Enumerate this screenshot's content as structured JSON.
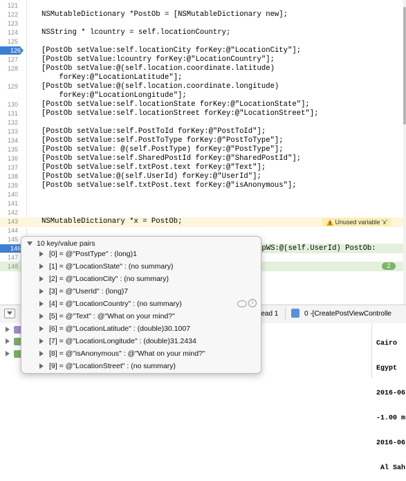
{
  "code_lines": [
    {
      "n": "121",
      "text": ""
    },
    {
      "n": "122",
      "text": "NSMutableDictionary *PostOb = [NSMutableDictionary new];"
    },
    {
      "n": "123",
      "text": ""
    },
    {
      "n": "124",
      "text": "NSString * lcountry = self.locationCountry;"
    },
    {
      "n": "125",
      "text": ""
    },
    {
      "n": "126",
      "text": "[PostOb setValue:self.locationCity forKey:@\"LocationCity\"];"
    },
    {
      "n": "127",
      "text": "[PostOb setValue:lcountry forKey:@\"LocationCountry\"];"
    },
    {
      "n": "128",
      "text": "[PostOb setValue:@(self.location.coordinate.latitude)"
    },
    {
      "n": "",
      "text": "    forKey:@\"LocationLatitude\"];"
    },
    {
      "n": "129",
      "text": "[PostOb setValue:@(self.location.coordinate.longitude)"
    },
    {
      "n": "",
      "text": "    forKey:@\"LocationLongitude\"];"
    },
    {
      "n": "130",
      "text": "[PostOb setValue:self.locationState forKey:@\"LocationState\"];"
    },
    {
      "n": "131",
      "text": "[PostOb setValue:self.locationStreet forKey:@\"LocationStreet\"];"
    },
    {
      "n": "132",
      "text": ""
    },
    {
      "n": "133",
      "text": "[PostOb setValue:self.PostToId forKey:@\"PostToId\"];"
    },
    {
      "n": "134",
      "text": "[PostOb setValue:self.PostToType forKey:@\"PostToType\"];"
    },
    {
      "n": "135",
      "text": "[PostOb setValue: @(self.PostType) forKey:@\"PostType\"];"
    },
    {
      "n": "136",
      "text": "[PostOb setValue:self.SharedPostId forKey:@\"SharedPostId\"];"
    },
    {
      "n": "137",
      "text": "[PostOb setValue:self.txtPost.text forKey:@\"Text\"];"
    },
    {
      "n": "138",
      "text": "[PostOb setValue:@(self.UserId) forKey:@\"UserId\"];"
    },
    {
      "n": "139",
      "text": "[PostOb setValue:self.txtPost.text forKey:@\"isAnonymous\"];"
    },
    {
      "n": "140",
      "text": ""
    },
    {
      "n": "141",
      "text": ""
    },
    {
      "n": "142",
      "text": ""
    },
    {
      "n": "143",
      "text": "NSMutableDictionary *x = PostOb;"
    },
    {
      "n": "144",
      "text": ""
    },
    {
      "n": "145",
      "text": ""
    },
    {
      "n": "146",
      "text": "ipWS:@(self.UserId) PostOb:"
    },
    {
      "n": "147",
      "text": ""
    },
    {
      "n": "148",
      "text": ""
    }
  ],
  "breakpoint_line": "126",
  "pc_line": "146",
  "warning_line": "143",
  "warning_text": "Unused variable 'x'",
  "thread_badge": "2",
  "debugbar": {
    "thread_label": "read 1",
    "frame_label": "0 -[CreatePostViewControlle"
  },
  "console_lines": [
    "Cairo",
    "Egypt",
    "2016-06",
    "-1.00 m",
    "2016-06",
    " Al Sah"
  ],
  "popover": {
    "header": "10 key/value pairs",
    "rows": [
      "[0] = @\"PostType\" : (long)1",
      "[1] = @\"LocationState\" : (no summary)",
      "[2] = @\"LocationCity\" : (no summary)",
      "[3] = @\"UserId\" : (long)7",
      "[4] = @\"LocationCountry\" : (no summary)",
      "[5] = @\"Text\" : @\"What on your mind?\"",
      "[6] = @\"LocationLatitude\" : (double)30.1007",
      "[7] = @\"LocationLongitude\" : (double)31.2434",
      "[8] = @\"isAnonymous\" : @\"What on your mind?\"",
      "[9] = @\"LocationStreet\" : (no summary)"
    ]
  },
  "colors": {
    "breakpoint": "#3e7fd6",
    "warning": "#e8a400",
    "pc_highlight": "#e3f1dc"
  }
}
